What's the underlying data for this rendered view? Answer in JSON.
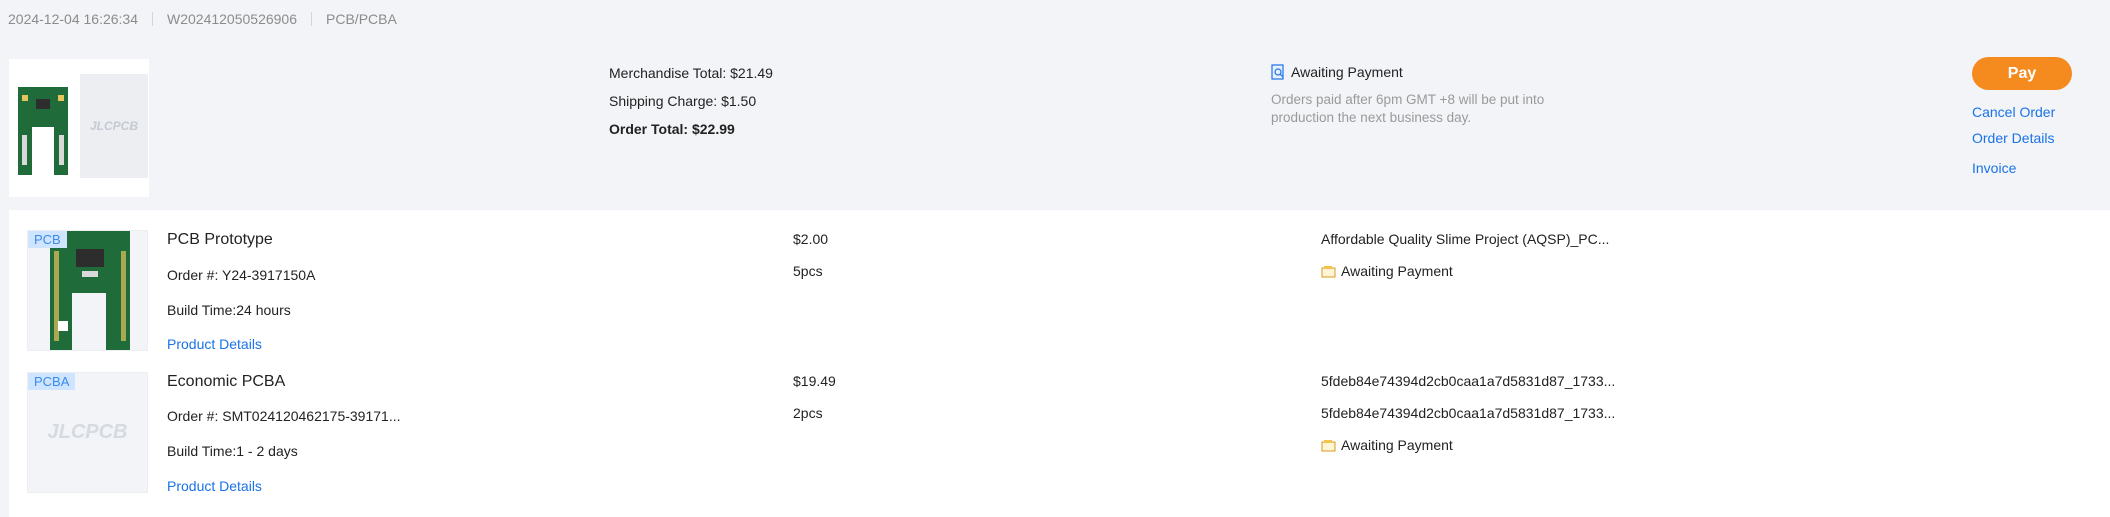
{
  "header": {
    "datetime": "2024-12-04 16:26:34",
    "order_id": "W202412050526906",
    "category": "PCB/PCBA"
  },
  "summary": {
    "merchandise_total": "Merchandise Total: $21.49",
    "shipping_charge": "Shipping Charge: $1.50",
    "order_total": "Order Total: $22.99",
    "thumb_placeholder": "JLCPCB",
    "status": "Awaiting Payment",
    "status_note": "Orders paid after 6pm GMT +8 will be put into production the next business day.",
    "actions": {
      "pay": "Pay",
      "cancel": "Cancel Order",
      "details": "Order Details",
      "invoice": "Invoice"
    }
  },
  "items": [
    {
      "tag": "PCB",
      "name": "PCB Prototype",
      "order_no": "Order #: Y24-3917150A",
      "build_time": "Build Time:24 hours",
      "details_link": "Product Details",
      "price": "$2.00",
      "qty": "5pcs",
      "file": "Affordable Quality Slime Project (AQSP)_PC...",
      "status": "Awaiting Payment"
    },
    {
      "tag": "PCBA",
      "placeholder": "JLCPCB",
      "name": "Economic PCBA",
      "order_no": "Order #: SMT024120462175-39171...",
      "build_time": "Build Time:1 - 2 days",
      "details_link": "Product Details",
      "price": "$19.49",
      "qty": "2pcs",
      "file1": "5fdeb84e74394d2cb0caa1a7d5831d87_1733...",
      "file2": "5fdeb84e74394d2cb0caa1a7d5831d87_1733...",
      "status": "Awaiting Payment"
    }
  ],
  "colors": {
    "accent": "#f58a1f",
    "link": "#1a73e8",
    "pcb_green": "#1f6b3a"
  }
}
